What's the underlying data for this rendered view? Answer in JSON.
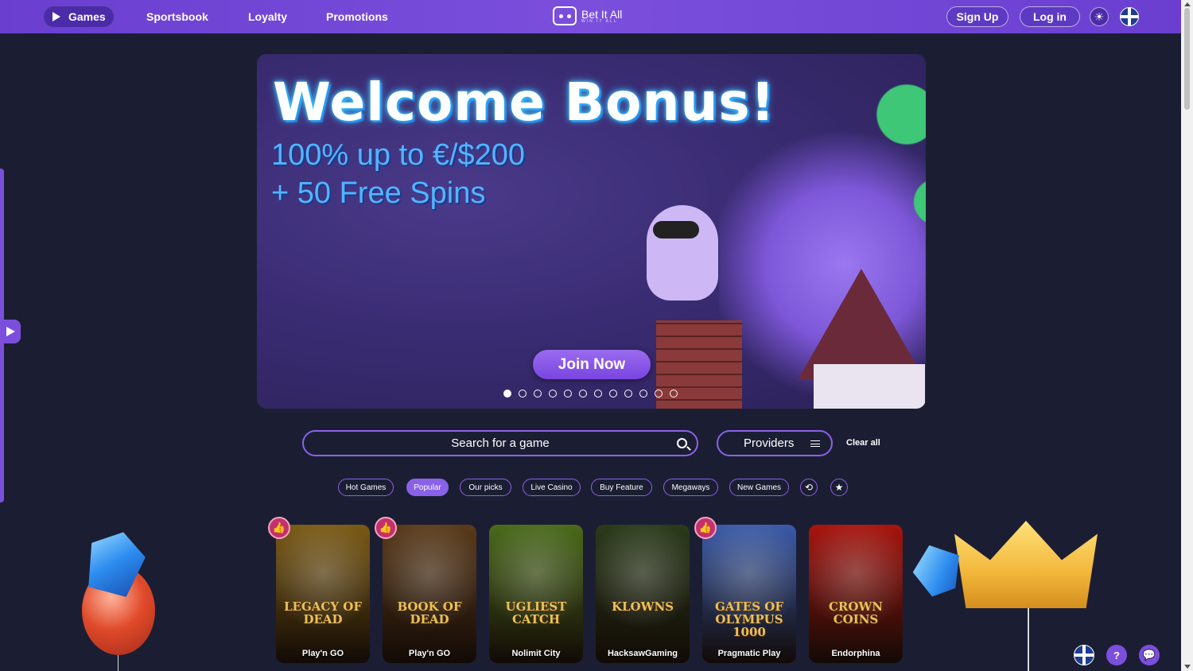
{
  "nav": {
    "games": "Games",
    "sportsbook": "Sportsbook",
    "loyalty": "Loyalty",
    "promotions": "Promotions"
  },
  "logo": {
    "name": "Bet It All",
    "tagline": "WIN IT ALL"
  },
  "auth": {
    "signup": "Sign Up",
    "login": "Log in"
  },
  "banner": {
    "title": "Welcome Bonus!",
    "line1": "100% up to €/$200",
    "line2": "+ 50 Free Spins",
    "cta": "Join Now",
    "slide_count": 12,
    "active_slide": 1
  },
  "search": {
    "placeholder": "Search for a game",
    "providers": "Providers",
    "clear": "Clear all"
  },
  "filters": [
    {
      "label": "Hot Games",
      "active": false
    },
    {
      "label": "Popular",
      "active": true
    },
    {
      "label": "Our picks",
      "active": false
    },
    {
      "label": "Live Casino",
      "active": false
    },
    {
      "label": "Buy Feature",
      "active": false
    },
    {
      "label": "Megaways",
      "active": false
    },
    {
      "label": "New Games",
      "active": false
    }
  ],
  "games": [
    {
      "title_art": "LEGACY OF DEAD",
      "provider": "Play'n GO",
      "badge": true,
      "bg": "#7a5a14"
    },
    {
      "title_art": "BOOK OF DEAD",
      "provider": "Play'n GO",
      "badge": true,
      "bg": "#5a3a1a"
    },
    {
      "title_art": "UGLIEST CATCH",
      "provider": "Nolimit City",
      "badge": false,
      "bg": "#4a6a1a"
    },
    {
      "title_art": "KLOWNS",
      "provider": "HacksawGaming",
      "badge": false,
      "bg": "#2a3a1a"
    },
    {
      "title_art": "GATES OF OLYMPUS 1000",
      "provider": "Pragmatic Play",
      "badge": true,
      "bg": "#3a5aa8"
    },
    {
      "title_art": "CROWN COINS",
      "provider": "Endorphina",
      "badge": false,
      "bg": "#a8140e"
    }
  ],
  "colors": {
    "accent": "#7b4fdc",
    "background": "#1b1e33",
    "badge": "#c4306c"
  }
}
